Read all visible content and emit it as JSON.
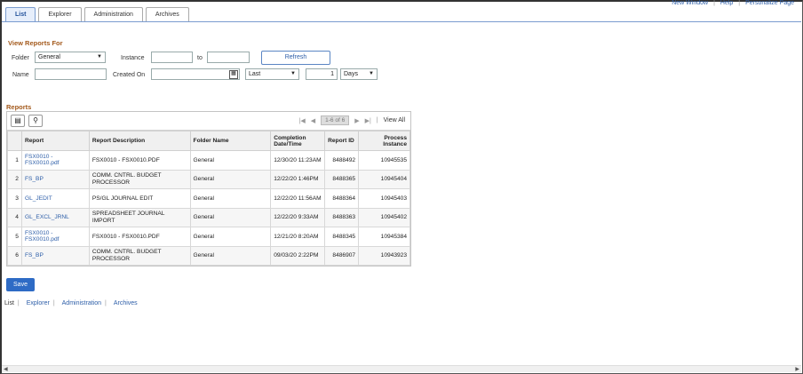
{
  "topnav": {
    "new_window": "New Window",
    "help": "Help",
    "personalize": "Personalize Page"
  },
  "tabs": [
    "List",
    "Explorer",
    "Administration",
    "Archives"
  ],
  "view_reports": {
    "title": "View Reports For",
    "folder_label": "Folder",
    "folder_value": "General",
    "instance_label": "Instance",
    "to_label": "to",
    "refresh": "Refresh",
    "name_label": "Name",
    "created_on_label": "Created On",
    "last_value": "Last",
    "days_count": "1",
    "days_value": "Days"
  },
  "reports": {
    "title": "Reports",
    "pager_count": "1-6 of 6",
    "view_all": "View All",
    "columns": [
      "Report",
      "Report Description",
      "Folder Name",
      "Completion Date/Time",
      "Report ID",
      "Process Instance"
    ],
    "rows": [
      {
        "n": "1",
        "report": "FSX0010 - FSX0010.pdf",
        "desc": "FSX0010 - FSX0010.PDF",
        "folder": "General",
        "date": "12/30/20 11:23AM",
        "id": "8488492",
        "inst": "10945535"
      },
      {
        "n": "2",
        "report": "FS_BP",
        "desc": "COMM. CNTRL. BUDGET PROCESSOR",
        "folder": "General",
        "date": "12/22/20  1:46PM",
        "id": "8488365",
        "inst": "10945404"
      },
      {
        "n": "3",
        "report": "GL_JEDIT",
        "desc": "PS/GL JOURNAL EDIT",
        "folder": "General",
        "date": "12/22/20 11:56AM",
        "id": "8488364",
        "inst": "10945403"
      },
      {
        "n": "4",
        "report": "GL_EXCL_JRNL",
        "desc": "SPREADSHEET JOURNAL IMPORT",
        "folder": "General",
        "date": "12/22/20  9:33AM",
        "id": "8488363",
        "inst": "10945402"
      },
      {
        "n": "5",
        "report": "FSX0010 - FSX0010.pdf",
        "desc": "FSX0010 - FSX0010.PDF",
        "folder": "General",
        "date": "12/21/20  8:20AM",
        "id": "8488345",
        "inst": "10945384"
      },
      {
        "n": "6",
        "report": "FS_BP",
        "desc": "COMM. CNTRL. BUDGET PROCESSOR",
        "folder": "General",
        "date": "09/03/20  2:22PM",
        "id": "8486907",
        "inst": "10943923"
      }
    ]
  },
  "save": "Save",
  "bottomnav": [
    "List",
    "Explorer",
    "Administration",
    "Archives"
  ]
}
